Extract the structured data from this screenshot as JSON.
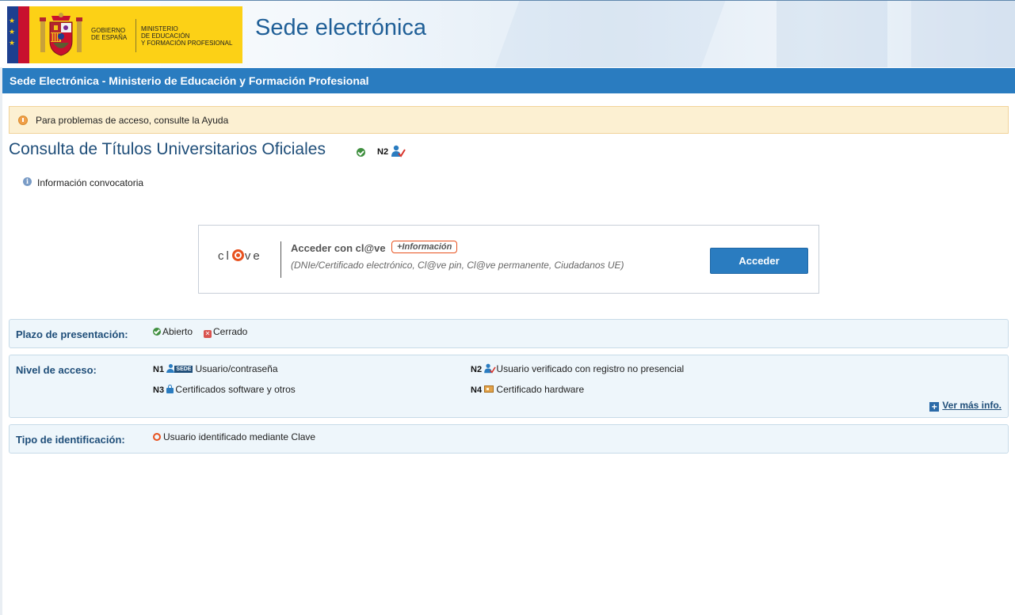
{
  "header": {
    "gov_line1": "GOBIERNO",
    "gov_line2": "DE ESPAÑA",
    "ministry_line1": "MINISTERIO",
    "ministry_line2": "DE EDUCACIÓN",
    "ministry_line3": "Y FORMACIÓN PROFESIONAL",
    "site_title": "Sede electrónica"
  },
  "bluebar": {
    "title": "Sede Electrónica - Ministerio de Educación y Formación Profesional"
  },
  "alert": {
    "text": "Para problemas de acceso, consulte la Ayuda"
  },
  "procedure": {
    "title": "Consulta de Títulos Universitarios Oficiales",
    "level": "N2",
    "info_link": "Información convocatoria"
  },
  "clave": {
    "logo_left": "cl",
    "logo_right": "ve",
    "label": "Acceder con cl@ve",
    "more_info": "+Información",
    "description": "(DNIe/Certificado electrónico, Cl@ve pin, Cl@ve permanente, Ciudadanos UE)",
    "button": "Acceder"
  },
  "plazo": {
    "label": "Plazo de presentación:",
    "open": "Abierto",
    "closed": "Cerrado"
  },
  "nivel": {
    "label": "Nivel de acceso:",
    "n1_code": "N1",
    "n1_tag": "SEDE",
    "n1_text": "Usuario/contraseña",
    "n2_code": "N2",
    "n2_text": "Usuario verificado con registro no presencial",
    "n3_code": "N3",
    "n3_text": "Certificados software y otros",
    "n4_code": "N4",
    "n4_text": "Certificado hardware",
    "more": "Ver más info."
  },
  "tipo": {
    "label": "Tipo de identificación:",
    "value": "Usuario identificado mediante Clave"
  },
  "colors": {
    "brand_blue": "#2a7cc0",
    "clave_orange": "#e8521f",
    "title_blue": "#1f4e79"
  }
}
